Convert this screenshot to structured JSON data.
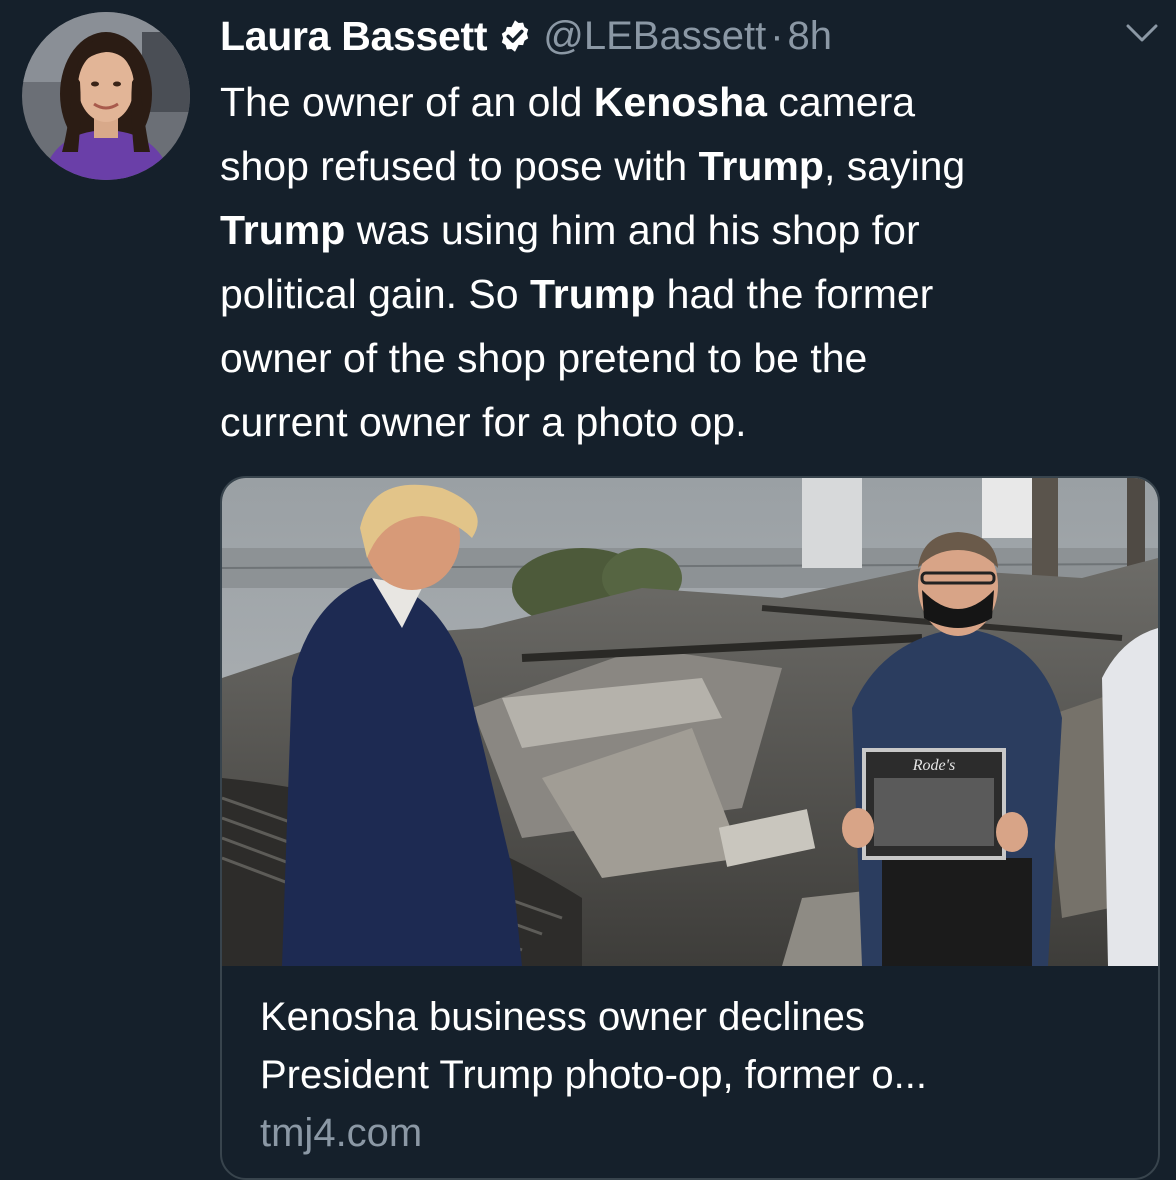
{
  "tweet": {
    "author": {
      "name": "Laura Bassett",
      "handle": "@LEBassett",
      "verified": true
    },
    "separator": "·",
    "timestamp": "8h",
    "text_lines": [
      [
        {
          "t": "The owner of an old ",
          "b": false
        },
        {
          "t": "Kenosha",
          "b": true
        },
        {
          "t": " camera",
          "b": false
        }
      ],
      [
        {
          "t": "shop refused to pose with ",
          "b": false
        },
        {
          "t": "Trump",
          "b": true
        },
        {
          "t": ", saying",
          "b": false
        }
      ],
      [
        {
          "t": "Trump",
          "b": true
        },
        {
          "t": " was using him and his shop for",
          "b": false
        }
      ],
      [
        {
          "t": "political gain. So ",
          "b": false
        },
        {
          "t": "Trump",
          "b": true
        },
        {
          "t": " had the former",
          "b": false
        }
      ],
      [
        {
          "t": "owner of the shop pretend to be the",
          "b": false
        }
      ],
      [
        {
          "t": "current owner for a photo op.",
          "b": false
        }
      ]
    ],
    "link_card": {
      "title_lines": [
        "Kenosha business owner declines",
        "President Trump photo-op, former o..."
      ],
      "domain": "tmj4.com",
      "photo_sign_text": "Rode's"
    }
  },
  "colors": {
    "background": "#15202b",
    "text_primary": "#ffffff",
    "text_secondary": "#8b98a5",
    "card_border": "#38444d",
    "verified_badge": "#ffffff"
  },
  "icons": {
    "verified": "verified-badge-icon",
    "more": "chevron-down-icon"
  }
}
